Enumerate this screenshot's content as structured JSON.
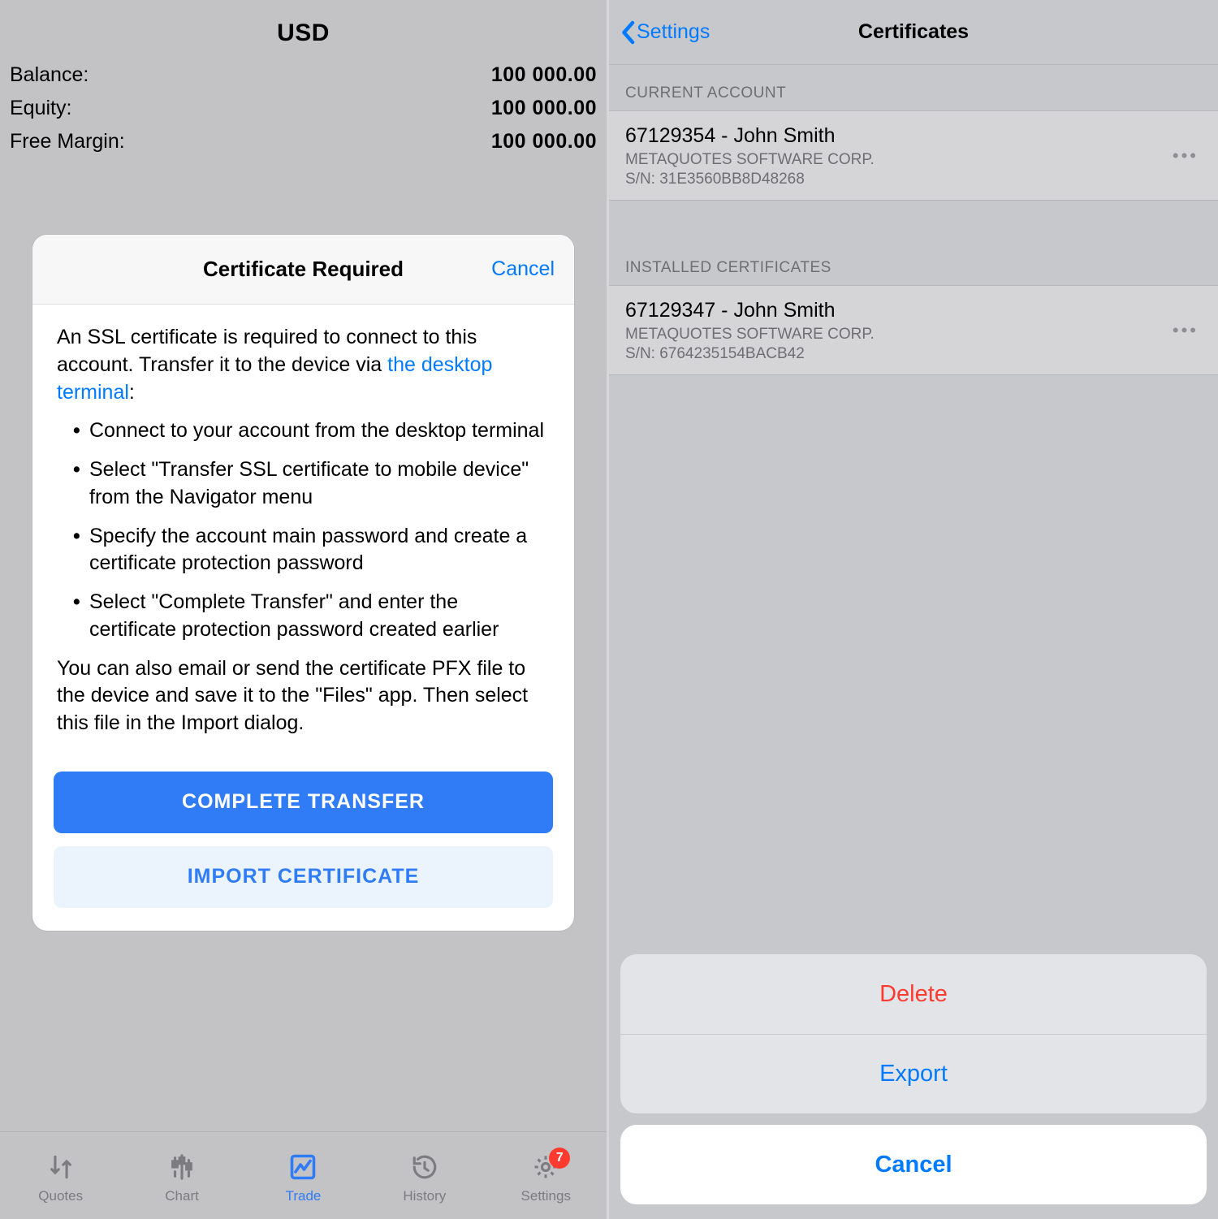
{
  "left": {
    "currency": "USD",
    "rows": [
      {
        "label": "Balance:",
        "value": "100 000.00"
      },
      {
        "label": "Equity:",
        "value": "100 000.00"
      },
      {
        "label": "Free Margin:",
        "value": "100 000.00"
      }
    ],
    "modal": {
      "title": "Certificate Required",
      "cancel": "Cancel",
      "intro_pre": "An SSL certificate is required to connect to this account. Transfer it to the device via ",
      "intro_link": "the desktop terminal",
      "intro_post": ":",
      "bullets": [
        "Connect to your account from the desktop terminal",
        "Select \"Transfer SSL certificate to mobile device\" from the Navigator menu",
        "Specify the account main password and create a certificate protection password",
        "Select \"Complete Transfer\" and enter the certificate protection password created earlier"
      ],
      "outro": "You can also email or send the certificate PFX file to the device and save it to the \"Files\" app. Then select this file in the Import dialog.",
      "complete_btn": "COMPLETE TRANSFER",
      "import_btn": "IMPORT CERTIFICATE"
    },
    "tabs": [
      {
        "label": "Quotes"
      },
      {
        "label": "Chart"
      },
      {
        "label": "Trade"
      },
      {
        "label": "History"
      },
      {
        "label": "Settings",
        "badge": "7"
      }
    ]
  },
  "right": {
    "back": "Settings",
    "title": "Certificates",
    "section1": "CURRENT ACCOUNT",
    "cert1": {
      "title": "67129354 - John Smith",
      "company": "METAQUOTES SOFTWARE CORP.",
      "sn": "S/N: 31E3560BB8D48268"
    },
    "section2": "INSTALLED CERTIFICATES",
    "cert2": {
      "title": "67129347 - John Smith",
      "company": "METAQUOTES SOFTWARE CORP.",
      "sn": "S/N: 6764235154BACB42"
    },
    "sheet": {
      "delete": "Delete",
      "export": "Export",
      "cancel": "Cancel"
    }
  }
}
